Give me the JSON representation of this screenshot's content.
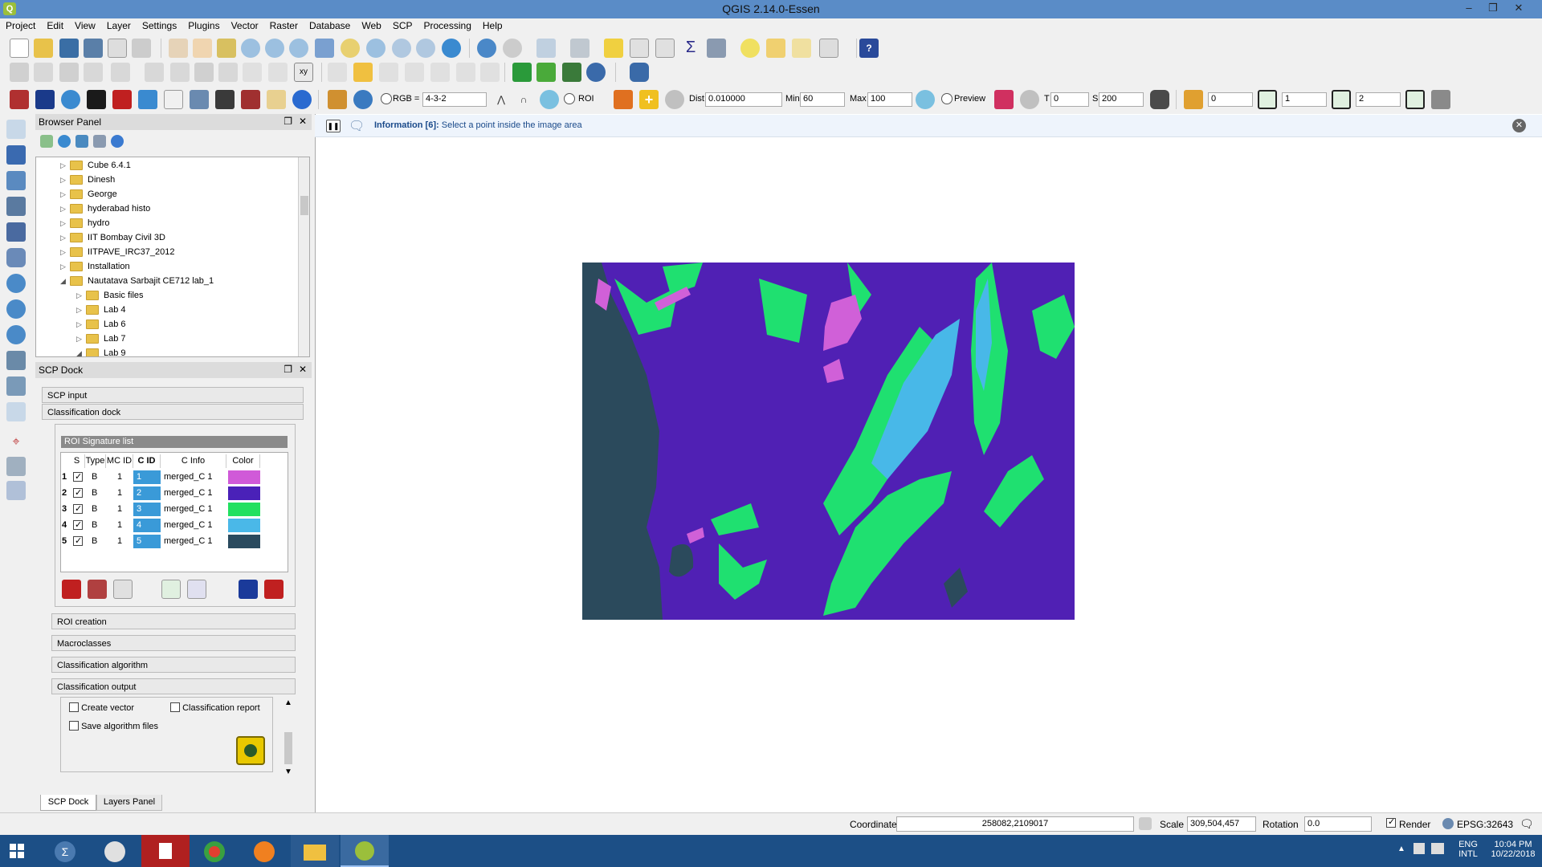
{
  "window": {
    "title": "QGIS 2.14.0-Essen",
    "min": "‒",
    "restore": "❐",
    "close": "✕",
    "app_icon": "Q"
  },
  "menu": [
    "Project",
    "Edit",
    "View",
    "Layer",
    "Settings",
    "Plugins",
    "Vector",
    "Raster",
    "Database",
    "Web",
    "SCP",
    "Processing",
    "Help"
  ],
  "scp_toolbar": {
    "rgb_label": "RGB =",
    "rgb_value": "4-3-2",
    "roi_label": "ROI",
    "dist_label": "Dist",
    "dist_value": "0.010000",
    "min_label": "Min",
    "min_value": "60",
    "max_label": "Max",
    "max_value": "100",
    "preview_label": "Preview",
    "t_label": "T",
    "t_value": "0",
    "s_label": "S",
    "s_value": "200",
    "band1": "0",
    "band2": "1",
    "band3": "2"
  },
  "browser_panel": {
    "title": "Browser Panel",
    "items": [
      {
        "label": "Cube 6.4.1",
        "arrow": "▷"
      },
      {
        "label": "Dinesh",
        "arrow": "▷"
      },
      {
        "label": "George",
        "arrow": "▷"
      },
      {
        "label": "hyderabad histo",
        "arrow": "▷"
      },
      {
        "label": "hydro",
        "arrow": "▷"
      },
      {
        "label": "IIT Bombay Civil 3D",
        "arrow": "▷"
      },
      {
        "label": "IITPAVE_IRC37_2012",
        "arrow": "▷"
      },
      {
        "label": "Installation",
        "arrow": "▷"
      },
      {
        "label": "Nautatava Sarbajit CE712 lab_1",
        "arrow": "◢"
      },
      {
        "label": "Basic files",
        "arrow": "▷"
      },
      {
        "label": "Lab 4",
        "arrow": "▷"
      },
      {
        "label": "Lab 6",
        "arrow": "▷"
      },
      {
        "label": "Lab 7",
        "arrow": "▷"
      },
      {
        "label": "Lab 9",
        "arrow": "◢"
      }
    ]
  },
  "scp_dock": {
    "title": "SCP Dock",
    "scp_input": "SCP input",
    "classification_dock": "Classification dock",
    "roi_signature_list": "ROI Signature list",
    "columns": [
      "S",
      "Type",
      "MC ID",
      "C ID",
      "C Info",
      "Color"
    ],
    "rows": [
      {
        "num": "1",
        "type": "B",
        "mc_id": "1",
        "c_id": "1",
        "c_info": "merged_C 1",
        "color": "#d05ad8"
      },
      {
        "num": "2",
        "type": "B",
        "mc_id": "1",
        "c_id": "2",
        "c_info": "merged_C 1",
        "color": "#4a21b8"
      },
      {
        "num": "3",
        "type": "B",
        "mc_id": "1",
        "c_id": "3",
        "c_info": "merged_C 1",
        "color": "#22e060"
      },
      {
        "num": "4",
        "type": "B",
        "mc_id": "1",
        "c_id": "4",
        "c_info": "merged_C 1",
        "color": "#4ab8e8"
      },
      {
        "num": "5",
        "type": "B",
        "mc_id": "1",
        "c_id": "5",
        "c_info": "merged_C 1",
        "color": "#2a4a5e"
      }
    ],
    "roi_creation": "ROI creation",
    "macroclasses": "Macroclasses",
    "classification_algorithm": "Classification algorithm",
    "classification_output": "Classification output",
    "create_vector": "Create vector",
    "classification_report": "Classification report",
    "save_algorithm_files": "Save algorithm files",
    "tabs": [
      "SCP Dock",
      "Layers Panel"
    ]
  },
  "info_bar": {
    "label": "Information [6]:",
    "message": "Select a point inside the image area"
  },
  "map_colors": {
    "water": "#2b4a5c",
    "land": "#5020b4",
    "vegetation": "#1fe070",
    "shallow": "#48b8e8",
    "urban": "#d060d8"
  },
  "status": {
    "coordinate_label": "Coordinate",
    "coordinate_value": "258082,2109017",
    "scale_label": "Scale",
    "scale_value": "309,504,457",
    "rotation_label": "Rotation",
    "rotation_value": "0.0",
    "render_label": "Render",
    "crs": "EPSG:32643"
  },
  "taskbar": {
    "lang1": "ENG",
    "lang2": "INTL",
    "time": "10:04 PM",
    "date": "10/22/2018"
  }
}
